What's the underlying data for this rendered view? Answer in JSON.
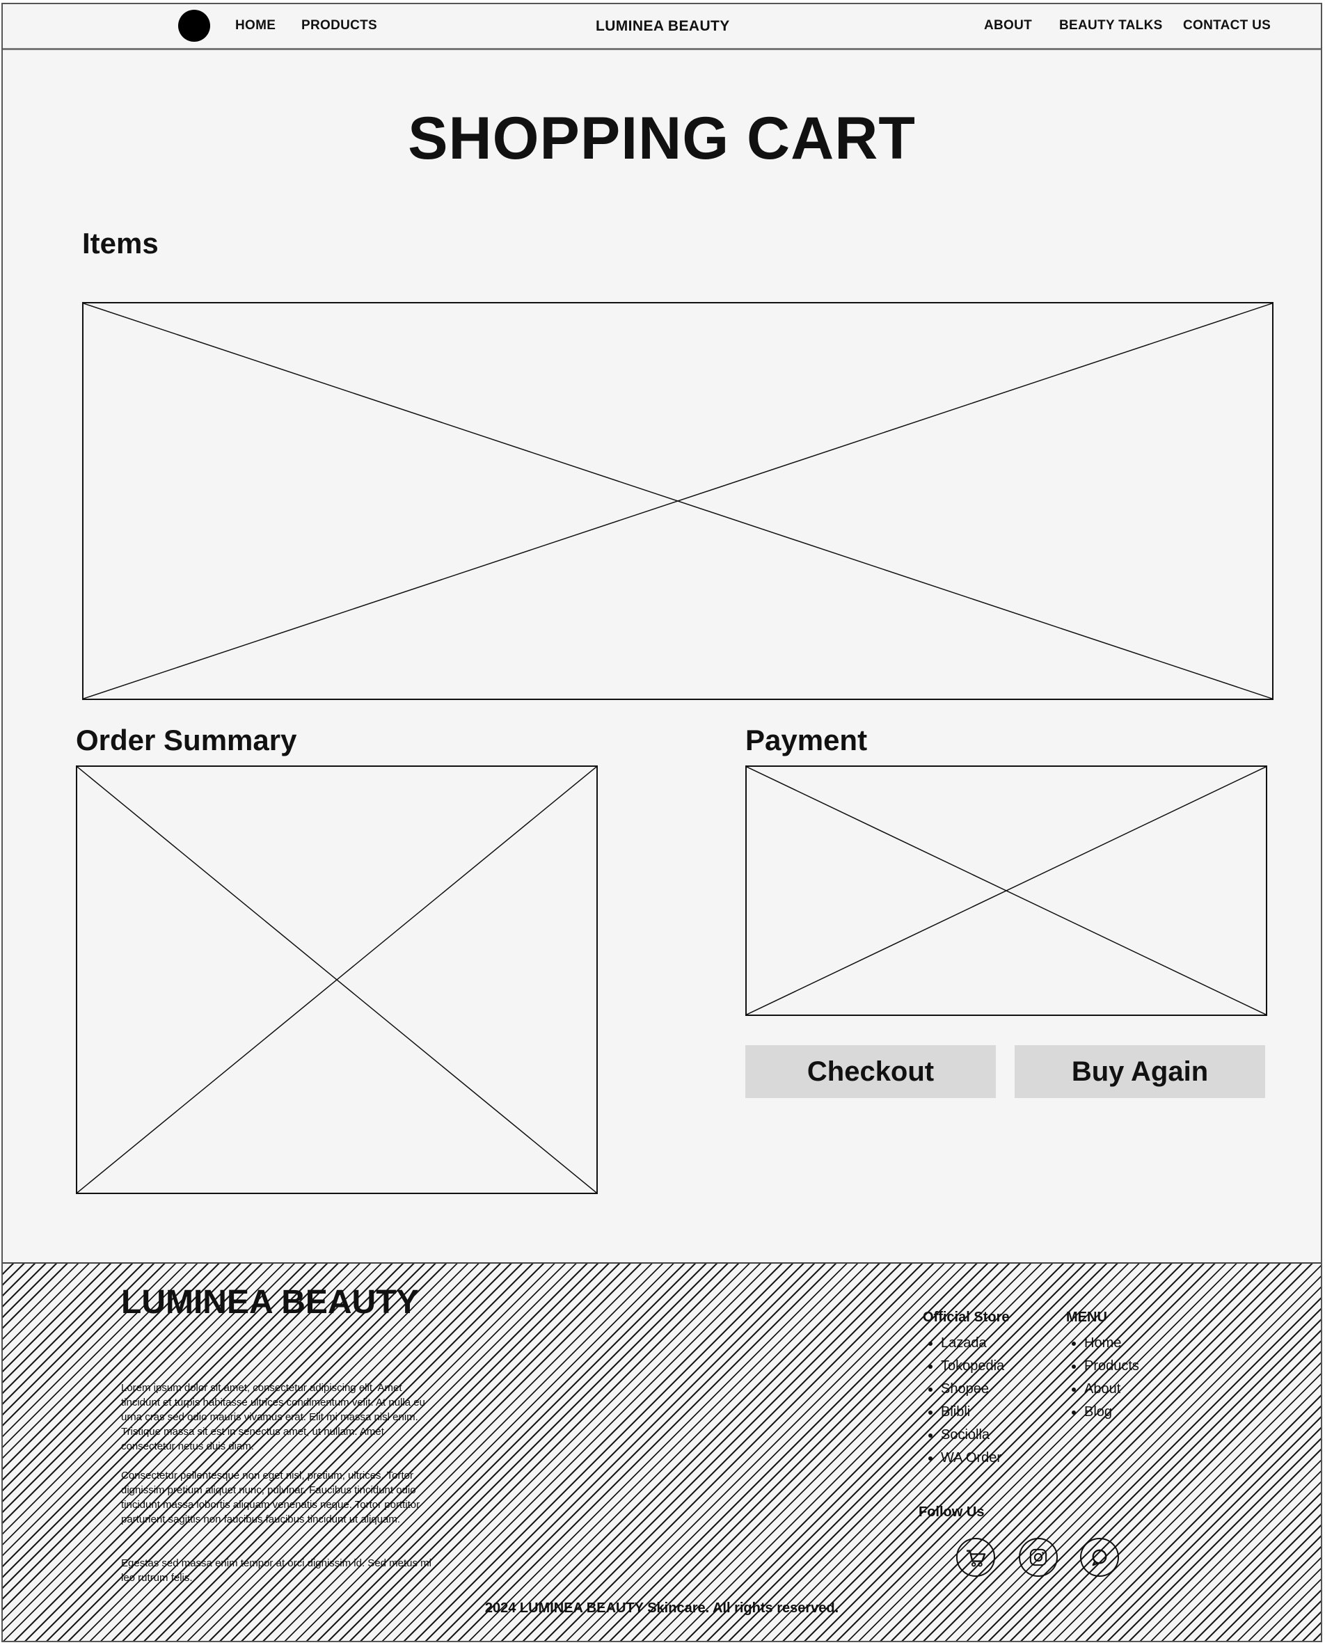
{
  "header": {
    "nav_left": [
      "HOME",
      "PRODUCTS"
    ],
    "brand": "LUMINEA BEAUTY",
    "nav_right": [
      "ABOUT",
      "BEAUTY TALKS",
      "CONTACT US"
    ]
  },
  "main": {
    "title": "SHOPPING CART",
    "items_heading": "Items",
    "order_summary_heading": "Order Summary",
    "payment_heading": "Payment",
    "checkout_label": "Checkout",
    "buy_again_label": "Buy Again"
  },
  "footer": {
    "brand": "LUMINEA BEAUTY",
    "paragraphs": [
      "Lorem ipsum dolor sit amet, consectetur adipiscing elit. Amet tincidunt et turpis habitasse ultrices condimentum velit. At nulla eu urna cras sed odio mauris vivamus erat. Elit mi massa nisl enim. Tristique massa sit est in senectus amet, ut nullam. Amet consectetur netus duis diam.",
      "Consectetur pellentesque non eget nisl, pretium, ultrices. Tortor dignissim pretium aliquet nunc, pulvinar. Faucibus tincidunt odio tincidunt massa lobortis aliquam venenatis neque. Tortor porttitor parturient sagittis non faucibus faucibus tincidunt ut aliquam.",
      "Egestas sed massa enim tempor at orci dignissim id. Sed metus mi leo rutrum felis."
    ],
    "official_store": {
      "title": "Official Store",
      "items": [
        "Lazada",
        "Tokopedia",
        "Shopee",
        "Blibli",
        "Sociolla",
        "WA Order"
      ]
    },
    "menu": {
      "title": "MENU",
      "items": [
        "Home",
        "Products",
        "About",
        "Blog"
      ]
    },
    "follow_us": "Follow Us",
    "social_icons": [
      "shopping-cart-icon",
      "instagram-icon",
      "whatsapp-icon"
    ],
    "copyright": "2024 LUMINEA BEAUTY Skincare. All rights reserved."
  }
}
